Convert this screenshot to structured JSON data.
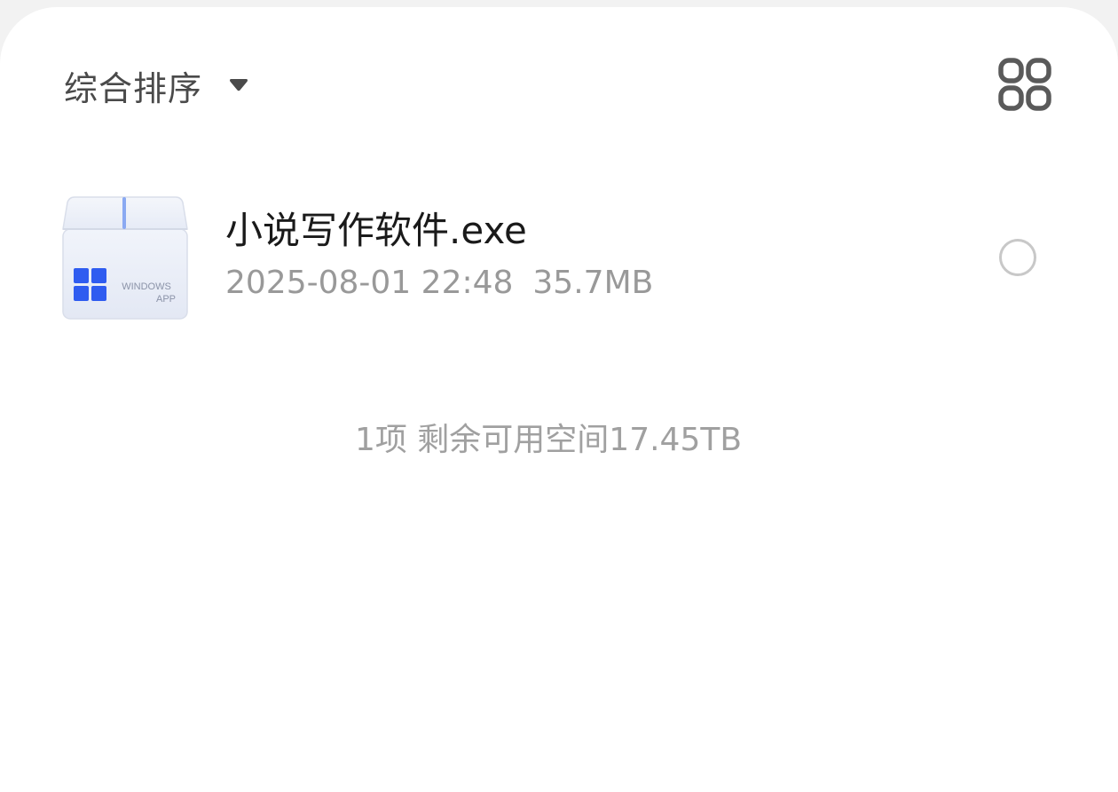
{
  "sort": {
    "label": "综合排序",
    "caret_icon": "caret-down-icon"
  },
  "view_toggle": {
    "icon": "grid-view-icon"
  },
  "files": [
    {
      "name": "小说写作软件.exe",
      "date": "2025-08-01 22:48",
      "size": "35.7MB",
      "icon": "windows-app-file-icon",
      "icon_text_line1": "WINDOWS",
      "icon_text_line2": "APP",
      "selected": false
    }
  ],
  "footer": {
    "summary": "1项 剩余可用空间17.45TB"
  },
  "colors": {
    "accent": "#2f5cf0",
    "text_primary": "#1a1a1a",
    "text_secondary": "#999999"
  }
}
